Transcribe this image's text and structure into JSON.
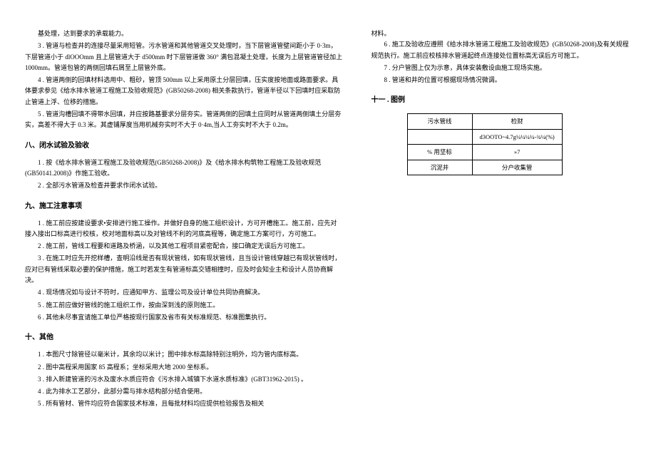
{
  "col1": {
    "p0": "基处理，达到要求的承载能力。",
    "p1": "3  . 管道与检查井的连接尽量采用短管。污水管道和其他管道交叉处理时，当下层管道管壁间距小于 0·3m，下层管道小于 dlOOOmm 且上层管道大于 d500mm 时下层管道做 360° 满包混凝土处理，长度为上层管道管径加上 1000mm。管道包管的两侧回填石屑至上层管外底。",
    "p2": "4  . 管道两侧的回填材料选用中、粗砂，管顶 500mm 以上采用原土分层回填，压实度按地面或路面要求。具体要求参见《给水排水管道工程施工及验收规范》(GB50268-2008) 相关条款执行，管道半径以下回填时应采取防止管道上浮、位移的措施。",
    "p3": "5  . 管道沟槽回填不得带水回填，并应按路基要求分层夯实。管道两侧的回填土应同时从管道两侧填土分层夯实，高差不得大于 0.3 米。其虚铺厚度当用机械夯实时不大于 0·4m,当人工夯实时不大于 0.2m。",
    "h1": "八、闭水试验及验收",
    "p4": "1  . 按《给水排水管道工程施工及验收规范(GB50268-2008)》及《给水排水构筑物工程施工及验收规范(GB50141.2008)》作施工验收。",
    "p5": "2  . 全部污水管道及检查井要求作闭水试验。",
    "h2": "九、施工注意事项",
    "p6": "1  . 施工前应按建设要求•安排进行施工操作。并做好自身的施工组织设计，方可开槽施工。施工前，应先对接入接出口标高进行校核，校对地面标高以及对管线不利的河底高程等，确定施工方案可行，方可施工。",
    "p7": "2  . 施工前，管线工程要和道路及桥涵，以及其他工程项目紧密配合，接口确定无误后方可施工。",
    "p8": "3  . 在施工时应先开挖样槽，查明沿线是否有现状管线，如有现状管线，且当设计管线穿越已有现状管线时，应对已有管线采取必要的保护措施，施工时若发生有管道标高交错相撞时，应及时会知业主和设计人员协商解决。",
    "p9": "4  . 现场情况如与设计不符时，应通知甲方、监理公司及设计单位共同协商解决。",
    "p10": "5  . 施工前应做好管线的施工组织工作，按由深到浅的原则施工。",
    "p11": "6  . 其他未尽事宜请施工单位严格按现行国家及省市有关标准规范、标准图集执行。",
    "h3": "十、其他",
    "p12": "1  . 本图尺寸除管径以毫米计，其余均以米计；图中排水标高除特别注明外，均为管内底标高。",
    "p13": "2  . 图中高程采用国家 85 高程系；坐标采用大地 2000 坐标系。",
    "p14": "3  . 排入新建管道的污水及废水水质应符合《污水排入城镇下水道水质标准》(GBT31962-2015) 。",
    "p15": "4  . 此为排水工艺部分，此部分需与排水结构部分结合使用。",
    "p16": "5  . 所有管材、管件均应符合国家技术标准，且每批材料均应提供检验报告及相关"
  },
  "col2": {
    "p0": "材料。",
    "p1": "6  . 施工及验收应遵照《给水排水管道工程施工及验收规范》(GB50268-2008)及有关规程规范执行。施工前应校核排水管道起终点连接处位置标高无误后方可施工。",
    "p2": "7  . 分户管图上仅为示意，具体安装敷设由施工现场实施。",
    "p3": "8  . 管道和井的位置可根据现场情况微调。",
    "h1": "十一 . 图例",
    "table": {
      "r1c1": "污水管线",
      "r1c2": "检财",
      "r2c1": "",
      "r2c2": "d3OOTO~4.7g¼¼¼¼-¾¼(%)",
      "r3c1": "% 用坚标",
      "r3c2": "»7",
      "r4c1": "沉泥井",
      "r4c2": "分户收集管"
    }
  }
}
